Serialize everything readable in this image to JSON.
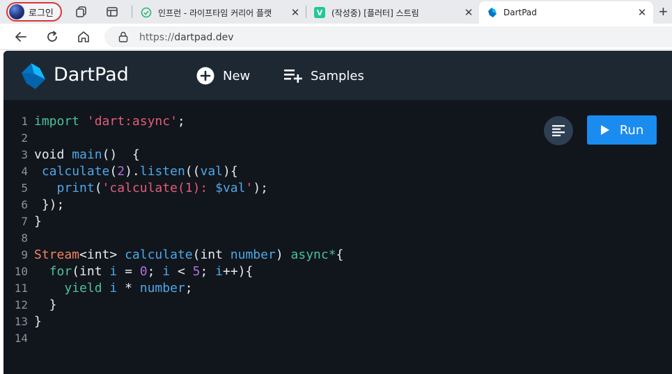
{
  "browser": {
    "profile_label": "로그인",
    "tabs": [
      {
        "title": "인프런 - 라이프타임 커리어 플랫",
        "close": "✕",
        "favicon": "inflearn-icon"
      },
      {
        "title": "(작성중) [플러터] 스트림",
        "close": "✕",
        "favicon": "v-icon",
        "favicon_letter": "V"
      },
      {
        "title": "DartPad",
        "close": "✕",
        "favicon": "dart-icon",
        "active": true
      }
    ],
    "new_tab": "+",
    "url_scheme": "https://",
    "url_host": "dartpad.dev"
  },
  "app": {
    "title": "DartPad",
    "new_label": "New",
    "samples_label": "Samples",
    "run_label": "Run"
  },
  "code_lines": [
    {
      "n": "1"
    },
    {
      "n": "2"
    },
    {
      "n": "3"
    },
    {
      "n": "4"
    },
    {
      "n": "5"
    },
    {
      "n": "6"
    },
    {
      "n": "7"
    },
    {
      "n": "8"
    },
    {
      "n": "9"
    },
    {
      "n": "10"
    },
    {
      "n": "11"
    },
    {
      "n": "12"
    },
    {
      "n": "13"
    },
    {
      "n": "14"
    }
  ],
  "code": {
    "l1": [
      "import",
      " ",
      "'dart:async'",
      ";"
    ],
    "l3": [
      "void",
      " ",
      "main",
      "()  {"
    ],
    "l4": [
      " ",
      "calculate",
      "(",
      "2",
      ").",
      "listen",
      "((",
      "val",
      "){"
    ],
    "l5": [
      "   ",
      "print",
      "(",
      "'calculate(1): ",
      "$val",
      "'",
      ");"
    ],
    "l6": [
      " });"
    ],
    "l7": [
      "}"
    ],
    "l9": [
      "Stream",
      "<int> ",
      "calculate",
      "(int ",
      "number",
      ") ",
      "async*",
      "{"
    ],
    "l10": [
      "  ",
      "for",
      "(int ",
      "i",
      " = ",
      "0",
      "; ",
      "i",
      " < ",
      "5",
      "; ",
      "i",
      "++){"
    ],
    "l11": [
      "    ",
      "yield",
      " ",
      "i",
      " * ",
      "number",
      ";"
    ],
    "l12": [
      "  }"
    ],
    "l13": [
      "}"
    ]
  },
  "colors": {
    "appbar": "#1e2833",
    "editor_bg": "#11151c",
    "keyword": "#4ac29a",
    "string": "#e35d79",
    "function": "#4ea8e6",
    "number": "#b06fde",
    "run_button": "#1a8cf0"
  }
}
